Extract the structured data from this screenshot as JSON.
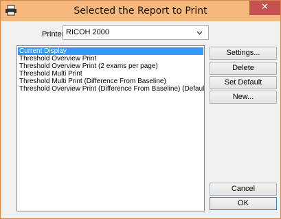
{
  "window": {
    "title": "Selected the Report to Print",
    "close_glyph": "✕"
  },
  "printer": {
    "label": "Printer",
    "value": "RICOH 2000"
  },
  "reports": [
    "Current Display",
    "Threshold Overview Print",
    "Threshold Overview Print (2 exams per page)",
    "Threshold Multi Print",
    "Threshold Multi Print (Difference From Baseline)",
    "Threshold Overview Print (Difference From Baseline) (Default)"
  ],
  "selected_report": "Current Display",
  "buttons": {
    "settings": "Settings...",
    "delete": "Delete",
    "set_default": "Set Default",
    "new": "New...",
    "cancel": "Cancel",
    "ok": "OK"
  },
  "colors": {
    "titlebar": "#f6b87d",
    "selection": "#3399ff",
    "close": "#c75050"
  },
  "icons": {
    "title": "printer-icon",
    "dropdown": "chevron-down-icon"
  }
}
